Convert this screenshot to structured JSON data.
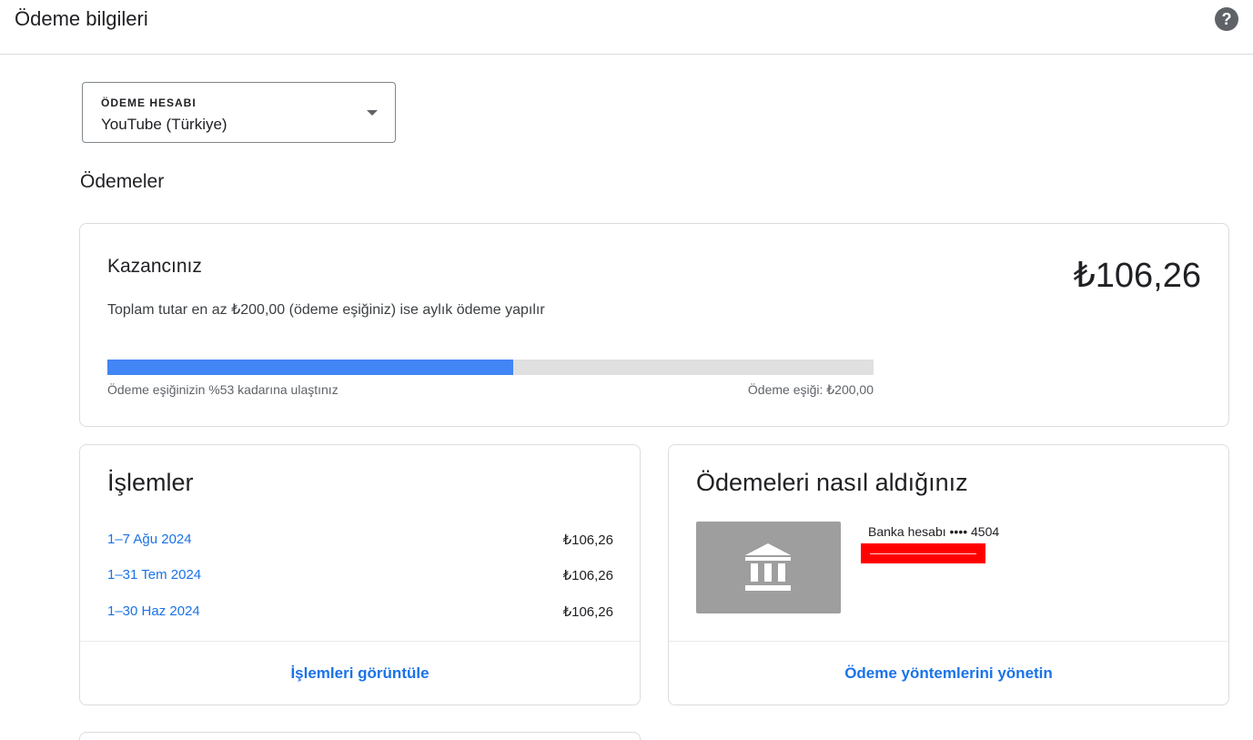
{
  "header": {
    "title": "Ödeme bilgileri",
    "help_icon": "help-circle-icon",
    "help_glyph": "?"
  },
  "account": {
    "label": "ÖDEME HESABI",
    "value": "YouTube (Türkiye)"
  },
  "payments_section": {
    "title": "Ödemeler"
  },
  "earnings": {
    "title": "Kazancınız",
    "amount": "₺106,26",
    "description": "Toplam tutar en az ₺200,00 (ödeme eşiğiniz) ise aylık ödeme yapılır",
    "progress_percent": 53,
    "reached_text": "Ödeme eşiğinizin %53 kadarına ulaştınız",
    "threshold_text": "Ödeme eşiği: ₺200,00",
    "colors": {
      "progress_fill": "#4285f4",
      "progress_track": "#e0e0e0"
    }
  },
  "transactions": {
    "title": "İşlemler",
    "rows": [
      {
        "date": "1–7 Ağu 2024",
        "amount": "₺106,26"
      },
      {
        "date": "1–31 Tem 2024",
        "amount": "₺106,26"
      },
      {
        "date": "1–30 Haz 2024",
        "amount": "₺106,26"
      }
    ],
    "view_link": "İşlemleri görüntüle"
  },
  "payment_method": {
    "title": "Ödemeleri nasıl aldığınız",
    "icon": "bank-icon",
    "bank_line": "Banka hesabı •••• 4504",
    "manage_link": "Ödeme yöntemlerini yönetin"
  },
  "colors": {
    "link": "#1a73e8",
    "redaction": "#ff0000"
  }
}
